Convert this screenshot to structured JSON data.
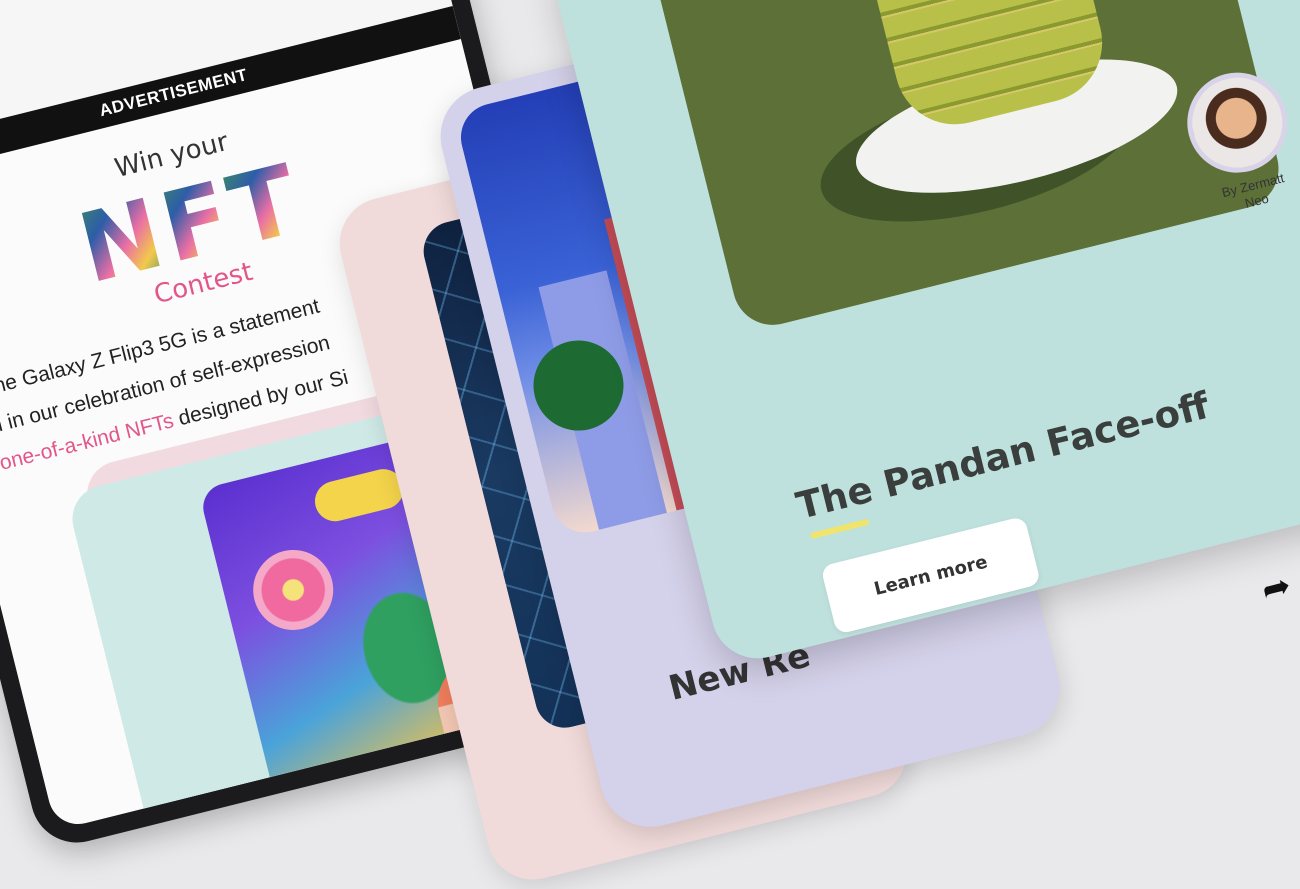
{
  "advertisement": {
    "banner": "ADVERTISEMENT",
    "win": "Win your",
    "nft": [
      "N",
      "F",
      "T"
    ],
    "contest": "Contest",
    "body_line1": "The Galaxy Z Flip3 5G is a statement",
    "body_line2": "n in our celebration of self-expression",
    "body_line3_link": "one-of-a-kind NFTs",
    "body_line3_rest": " designed by our Si"
  },
  "middle_card": {
    "heading": "New Re"
  },
  "front_card": {
    "title": "The Pandan Face-off",
    "by": "By Zermatt",
    "name": "Neo",
    "button": "Learn more"
  },
  "icons": [
    "camera-icon",
    "share-arrow-icon"
  ],
  "colors": {
    "accent_pink": "#e2568a",
    "mint": "#bfe1dd",
    "lavender": "#d4d1ea",
    "blush": "#f1dada"
  }
}
